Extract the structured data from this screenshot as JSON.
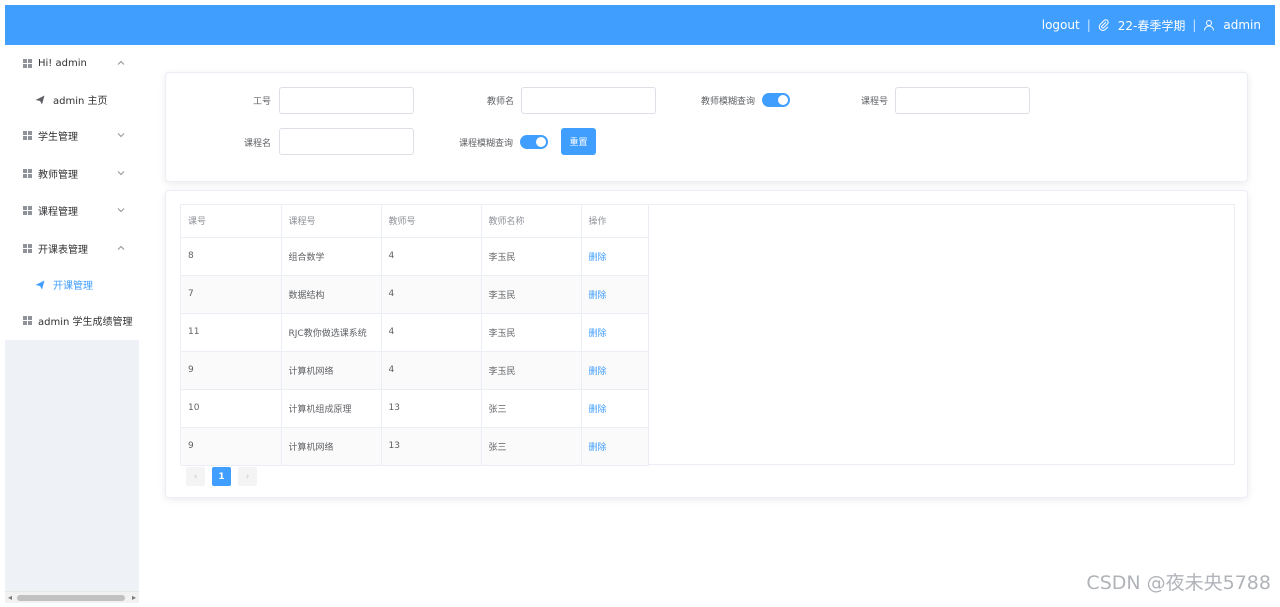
{
  "header": {
    "logout": "logout",
    "term": "22-春季学期",
    "user": "admin"
  },
  "sidebar": {
    "items": [
      {
        "label": "Hi! admin",
        "expanded": true,
        "children": [
          {
            "label": "admin 主页"
          }
        ]
      },
      {
        "label": "学生管理",
        "expanded": false
      },
      {
        "label": "教师管理",
        "expanded": false
      },
      {
        "label": "课程管理",
        "expanded": false
      },
      {
        "label": "开课表管理",
        "expanded": true,
        "children": [
          {
            "label": "开课管理",
            "active": true
          }
        ]
      },
      {
        "label": "admin 学生成绩管理"
      }
    ]
  },
  "search": {
    "teacher_id_label": "工号",
    "teacher_name_label": "教师名",
    "teacher_fuzzy_label": "教师模糊查询",
    "course_id_label": "课程号",
    "course_name_label": "课程名",
    "course_fuzzy_label": "课程模糊查询",
    "reset_label": "重置",
    "teacher_fuzzy_on": true,
    "course_fuzzy_on": true
  },
  "table": {
    "columns": [
      "课号",
      "课程号",
      "教师号",
      "教师名称",
      "操作"
    ],
    "rows": [
      [
        "8",
        "组合数学",
        "4",
        "李玉民",
        "删除"
      ],
      [
        "7",
        "数据结构",
        "4",
        "李玉民",
        "删除"
      ],
      [
        "11",
        "RJC教你做选课系统",
        "4",
        "李玉民",
        "删除"
      ],
      [
        "9",
        "计算机网络",
        "4",
        "李玉民",
        "删除"
      ],
      [
        "10",
        "计算机组成原理",
        "13",
        "张三",
        "删除"
      ],
      [
        "9",
        "计算机网络",
        "13",
        "张三",
        "删除"
      ]
    ]
  },
  "pagination": {
    "prev": "‹",
    "current": "1",
    "next": "›"
  },
  "watermark": "CSDN @夜未央5788",
  "colors": {
    "primary": "#409eff",
    "sidebar_bg": "#eef1f6"
  }
}
